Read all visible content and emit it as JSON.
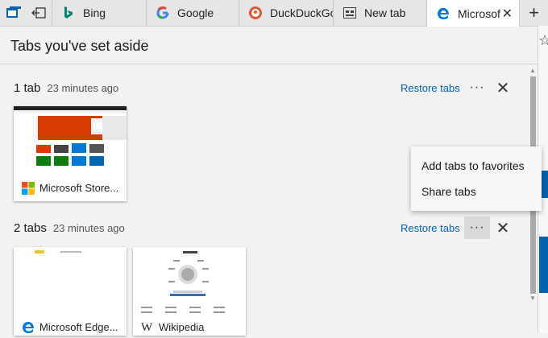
{
  "tabs": [
    {
      "title": "Bing",
      "icon": "bing-icon"
    },
    {
      "title": "Google",
      "icon": "google-icon"
    },
    {
      "title": "DuckDuckGo",
      "icon": "duckduckgo-icon"
    },
    {
      "title": "New tab",
      "icon": "newtab-icon"
    },
    {
      "title": "Microsof",
      "icon": "edge-icon",
      "active": true
    }
  ],
  "panel": {
    "title": "Tabs you've set aside",
    "groups": [
      {
        "count_label": "1 tab",
        "time": "23 minutes ago",
        "restore": "Restore tabs",
        "cards": [
          {
            "label": "Microsoft Store...",
            "icon": "microsoft-logo-icon"
          }
        ]
      },
      {
        "count_label": "2 tabs",
        "time": "23 minutes ago",
        "restore": "Restore tabs",
        "cards": [
          {
            "label": "Microsoft Edge...",
            "icon": "edge-icon"
          },
          {
            "label": "Wikipedia",
            "icon": "wikipedia-icon"
          }
        ]
      }
    ]
  },
  "menu": {
    "items": [
      "Add tabs to favorites",
      "Share tabs"
    ]
  },
  "colors": {
    "accent": "#0063b1",
    "panel_bg": "#f2f2f2",
    "tabbar_bg": "#e6e6e6"
  }
}
